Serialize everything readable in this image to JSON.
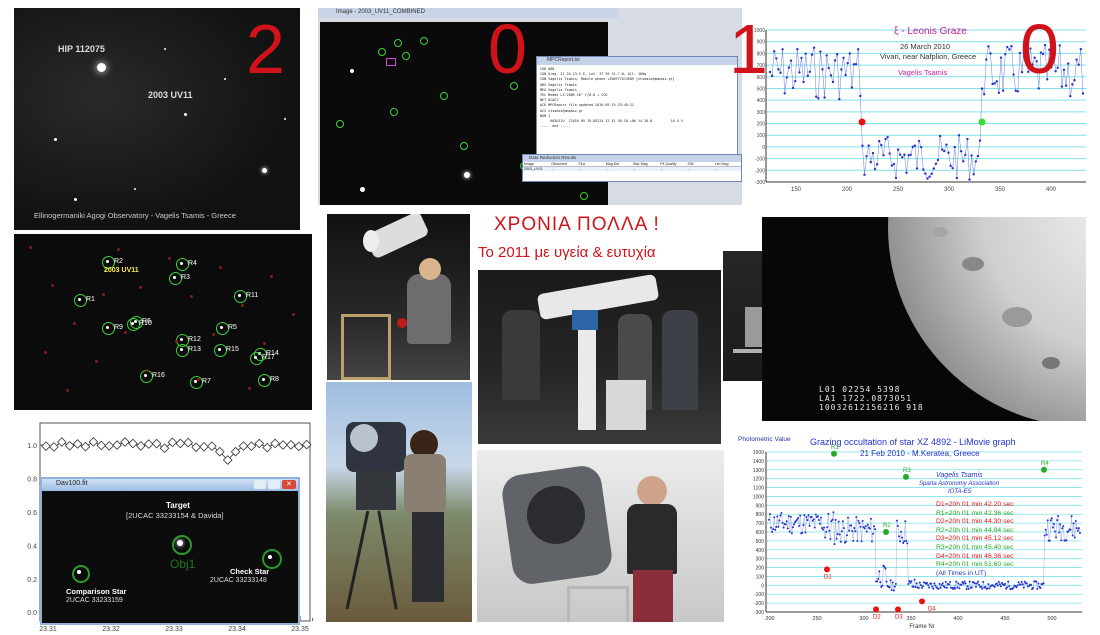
{
  "year_digits": [
    "2",
    "0",
    "1",
    "0"
  ],
  "greeting": {
    "line1": "ΧΡΟΝΙΑ ΠΟΛΛΑ !",
    "line2": "Το 2011 με υγεία & ευτυχία"
  },
  "asteroid_photo": {
    "star_label": "HIP 112075",
    "asteroid_label": "2003 UV11",
    "credit": "Ellinogermaniki Agogi Observatory  -  Vagelis Tsamis  -  Greece"
  },
  "field_chart": {
    "asteroid_label": "2003 UV11",
    "stars": [
      "R1",
      "R2",
      "R3",
      "R4",
      "R5",
      "R6",
      "R7",
      "R8",
      "R9",
      "R10",
      "R11",
      "R12",
      "R13",
      "R14",
      "R15",
      "R16",
      "R17"
    ]
  },
  "software_window": {
    "title": "Image - 2003_UV11_COMBINED",
    "report_title": "MPCReport.txt",
    "report_lines": [
      "COD A68",
      "CON Greg. 21 20 23.5 E, Lat. 37 59 31.7 N, Alt. 160m",
      "CON Vagelis Tsamis, Mobile phone +306977074589 [vtsamis@ampasz.gr]",
      "OBS Vagelis Tsamis",
      "MEA Vagelis Tsamis",
      "TEL Meade LX-200R 16\" f/8.0 + CCD",
      "NET UCAC2",
      "ACK MPCReport file updated 2010.09.19 23:45:21",
      "AC2 vtsamis@ampasz.gr",
      "NUM 1",
      "     K03U11U  C2010 09 19.89224 22 41 30.10 +06 14 26.8         16.4 V",
      "----- end -----"
    ],
    "results_title": "Data Reduction Results",
    "results_headers": [
      "Image",
      "Observed",
      "Flux",
      "Mag.Est",
      "Star Mag",
      "Fit Quality",
      "S/N",
      "Lim Mag"
    ],
    "results_row": [
      "2003_UV11",
      "...",
      "...",
      "...",
      "...",
      "...",
      "...",
      "..."
    ]
  },
  "xi_leonis_chart": {
    "title": "ξ - Leonis Graze",
    "date": "26 March 2010",
    "place": "Vivari, near Nafplion, Greece",
    "observer": "Vagelis Tsamis",
    "y_ticks": [
      "1000",
      "900",
      "800",
      "700",
      "600",
      "500",
      "400",
      "300",
      "200",
      "100",
      "0",
      "-100",
      "-200",
      "-300"
    ],
    "x_ticks": [
      "150",
      "200",
      "250",
      "300",
      "350",
      "400"
    ]
  },
  "light_curve": {
    "y_ticks": [
      "1.0",
      "0.8",
      "0.6",
      "0.4",
      "0.2",
      "0.0"
    ],
    "x_ticks": [
      "23.31",
      "23.32",
      "23.33",
      "23.34",
      "23.35"
    ],
    "window_title": "Dav100.fit",
    "target_label": "Target",
    "target_id": "[2UCAC 33233154 & Davida]",
    "obj_label": "Obj1",
    "comparison_label": "Comparison Star",
    "comparison_id": "2UCAC 33233159",
    "check_label": "Check Star",
    "check_id": "2UCAC 33233148"
  },
  "moon_photo": {
    "timestamp_lines": [
      "L01  02254  5398",
      "LA1  1722.0873051",
      "10032612156216 918"
    ]
  },
  "xz_chart": {
    "y_axis_title": "Photometric Value",
    "title": "Grazing occultation of star XZ 4892 - LiMovie graph",
    "subtitle": "21 Feb 2010 - M.Keratea, Greece",
    "observer": "Vagelis Tsamis",
    "association": "Sparta Astronomy Association",
    "org": "IOTA-ES",
    "events": [
      {
        "text": "D1=20h 01 min 42.20 sec",
        "color": "#ee1111"
      },
      {
        "text": "R1=20h 01 min 42.36 sec",
        "color": "#22aa22"
      },
      {
        "text": "D2=20h 01 min 44.30 sec",
        "color": "#ee1111"
      },
      {
        "text": "R2=20h 01 min 44.84 sec",
        "color": "#22aa22"
      },
      {
        "text": "D3=20h 01 min 45.12 sec",
        "color": "#ee1111"
      },
      {
        "text": "R3=20h 01 min 45.40 sec",
        "color": "#22aa22"
      },
      {
        "text": "D4=20h 01 min 46.36 sec",
        "color": "#ee1111"
      },
      {
        "text": "R4=20h 01 min 51.60 sec",
        "color": "#22aa22"
      },
      {
        "text": "(All Times in UT)",
        "color": "#2233cc"
      }
    ],
    "markers": {
      "R1": "R1",
      "R2": "R2",
      "R3": "R3",
      "R4": "R4",
      "D1": "D1",
      "D2": "D2",
      "D3": "D3",
      "D4": "D4"
    },
    "y_ticks": [
      "1500",
      "1400",
      "1300",
      "1200",
      "1100",
      "1000",
      "900",
      "800",
      "700",
      "600",
      "500",
      "400",
      "300",
      "200",
      "100",
      "0",
      "-100",
      "-200",
      "-300"
    ],
    "x_ticks": [
      "200",
      "250",
      "300",
      "350",
      "400",
      "450",
      "500"
    ],
    "x_axis_title": "Frame Nr"
  }
}
